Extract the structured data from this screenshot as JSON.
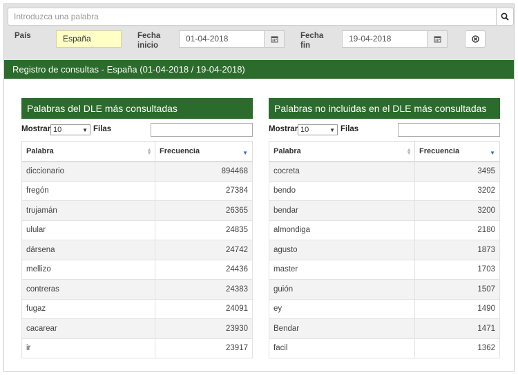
{
  "search": {
    "placeholder": "Introduzca una palabra"
  },
  "filters": {
    "pais_label": "País",
    "pais_value": "España",
    "fecha_inicio_label_1": "Fecha",
    "fecha_inicio_label_2": "inicio",
    "fecha_inicio_value": "01-04-2018",
    "fecha_fin_label_1": "Fecha",
    "fecha_fin_label_2": "fin",
    "fecha_fin_value": "19-04-2018"
  },
  "banner": {
    "title": "Registro de consultas - España (01-04-2018 / 19-04-2018)"
  },
  "left_panel": {
    "title": "Palabras del DLE más consultadas",
    "mostrar": "Mostrar",
    "rows_per_page": "10",
    "filas": "Filas",
    "columns": [
      "Palabra",
      "Frecuencia"
    ],
    "rows": [
      [
        "diccionario",
        "894468"
      ],
      [
        "fregón",
        "27384"
      ],
      [
        "trujamán",
        "26365"
      ],
      [
        "ulular",
        "24835"
      ],
      [
        "dársena",
        "24742"
      ],
      [
        "mellizo",
        "24436"
      ],
      [
        "contreras",
        "24383"
      ],
      [
        "fugaz",
        "24091"
      ],
      [
        "cacarear",
        "23930"
      ],
      [
        "ir",
        "23917"
      ]
    ]
  },
  "right_panel": {
    "title": "Palabras no incluidas en el DLE más consultadas",
    "mostrar": "Mostrar",
    "rows_per_page": "10",
    "filas": "Filas",
    "columns": [
      "Palabra",
      "Frecuencia"
    ],
    "rows": [
      [
        "cocreta",
        "3495"
      ],
      [
        "bendo",
        "3202"
      ],
      [
        "bendar",
        "3200"
      ],
      [
        "almondiga",
        "2180"
      ],
      [
        "agusto",
        "1873"
      ],
      [
        "master",
        "1703"
      ],
      [
        "guión",
        "1507"
      ],
      [
        "ey",
        "1490"
      ],
      [
        "Bendar",
        "1471"
      ],
      [
        "facil",
        "1362"
      ]
    ]
  },
  "colors": {
    "header_green": "#2b6b2b",
    "country_highlight": "#ffffc6",
    "sort_arrow": "#3a62c8"
  }
}
